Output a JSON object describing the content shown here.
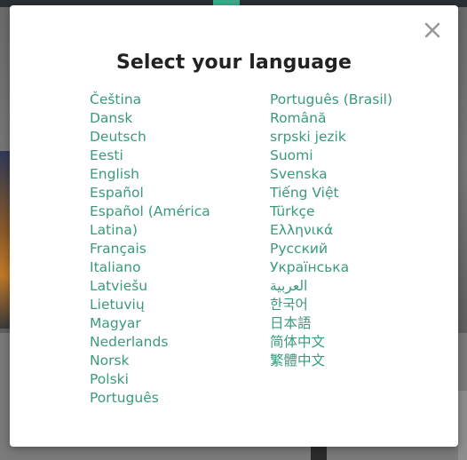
{
  "modal": {
    "title": "Select your language",
    "close_label": "×"
  },
  "languages": {
    "left": [
      "Čeština",
      "Dansk",
      "Deutsch",
      "Eesti",
      "English",
      "Español",
      "Español (América Latina)",
      "Français",
      "Italiano",
      "Latviešu",
      "Lietuvių",
      "Magyar",
      "Nederlands",
      "Norsk",
      "Polski",
      "Português"
    ],
    "right": [
      "Português (Brasil)",
      "Română",
      "srpski jezik",
      "Suomi",
      "Svenska",
      "Tiếng Việt",
      "Türkçe",
      "Ελληνικά",
      "Русский",
      "Українська",
      "العربية",
      "한국어",
      "日本語",
      "简体中文",
      "繁體中文"
    ]
  },
  "colors": {
    "link": "#3a9a7a",
    "title": "#222222",
    "modal_bg": "#ffffff",
    "close_icon": "#999999"
  }
}
